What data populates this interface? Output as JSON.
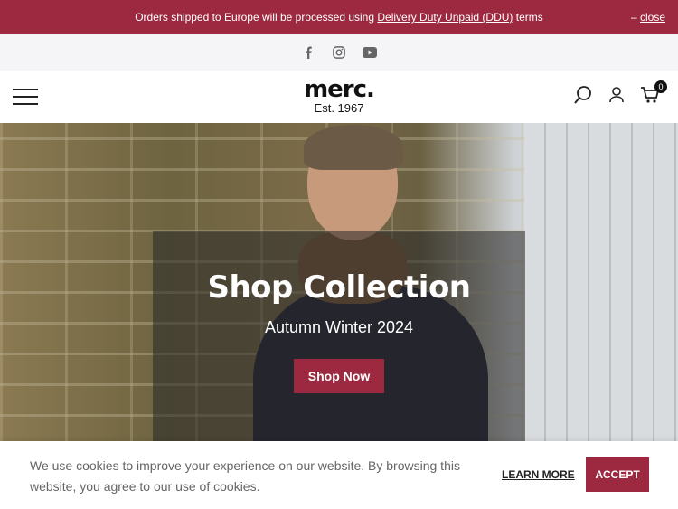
{
  "announcement": {
    "text_before": "Orders shipped to Europe will be processed using ",
    "link": "Delivery Duty Unpaid (DDU)",
    "text_after": " terms",
    "close_dash": "–",
    "close": "close"
  },
  "social": {
    "icons": [
      "facebook-icon",
      "instagram-icon",
      "youtube-icon"
    ]
  },
  "header": {
    "logo_mark": "merc.",
    "logo_est": "Est. 1967",
    "cart_count": "0"
  },
  "hero": {
    "title": "Shop Collection",
    "subtitle": "Autumn Winter 2024",
    "cta": "Shop Now"
  },
  "cookie": {
    "message": "We use cookies to improve your experience on our website. By browsing this website, you agree to our use of cookies.",
    "learn_more": "LEARN MORE",
    "accept": "ACCEPT"
  },
  "colors": {
    "brand": "#9c2940"
  }
}
